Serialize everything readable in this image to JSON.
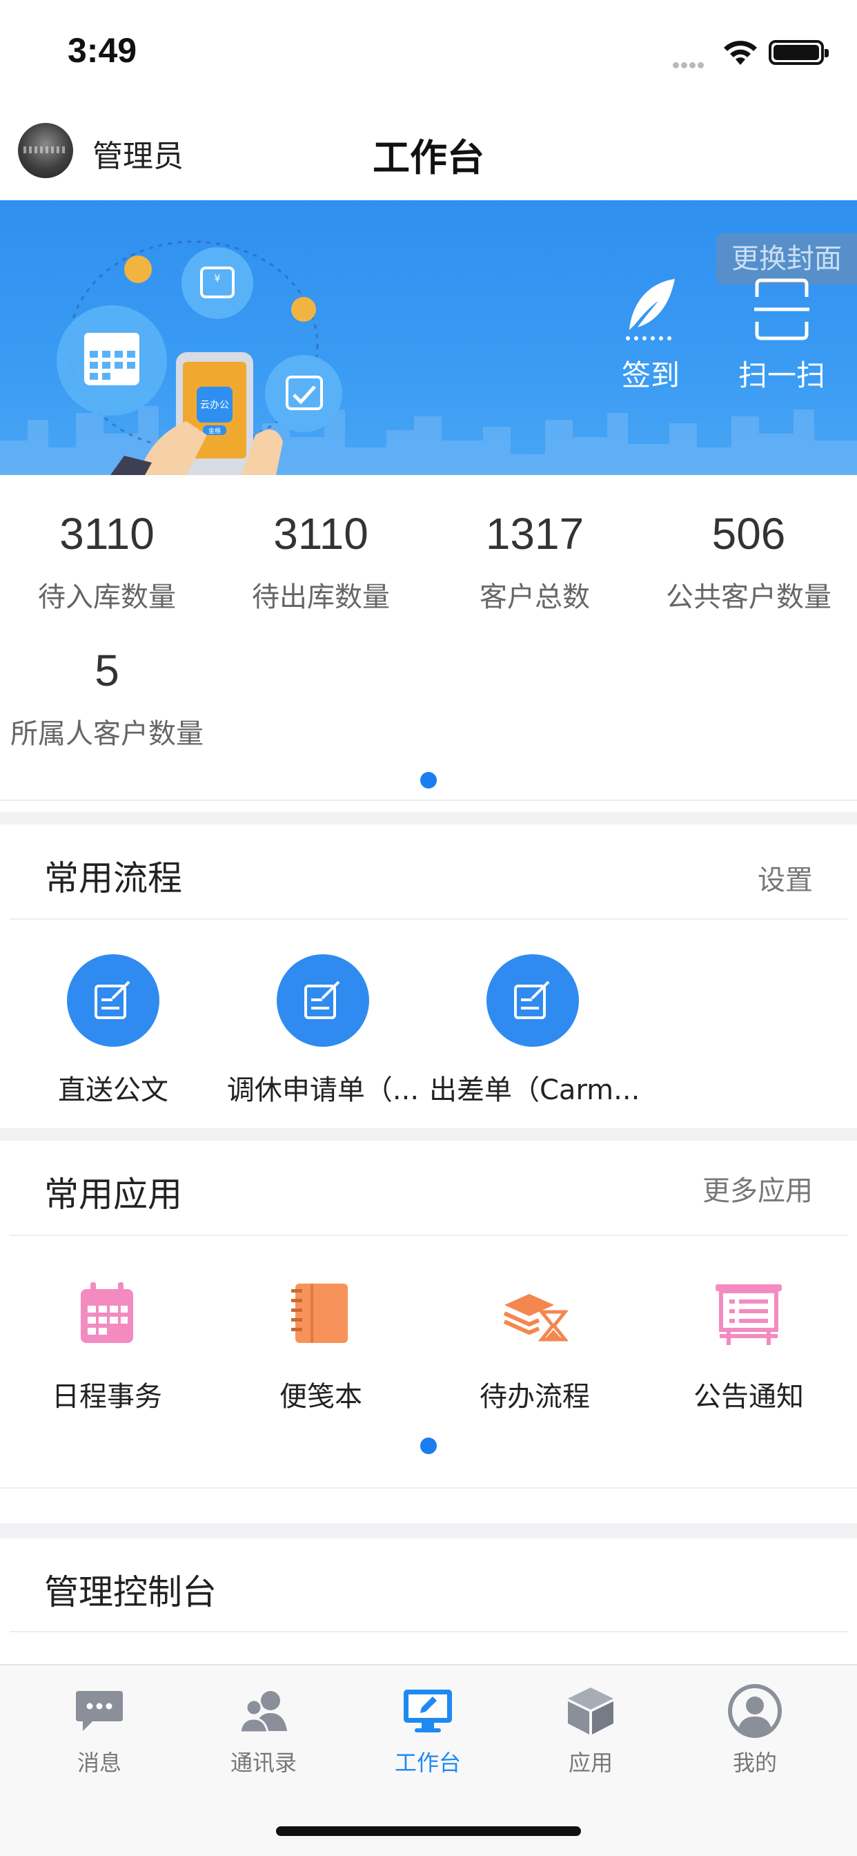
{
  "status_bar": {
    "time": "3:49"
  },
  "header": {
    "user_name": "管理员",
    "title": "工作台"
  },
  "banner": {
    "change_cover": "更换封面",
    "actions": [
      {
        "label": "签到",
        "icon": "feather-icon"
      },
      {
        "label": "扫一扫",
        "icon": "scan-icon"
      }
    ],
    "illustration_label": "云办公",
    "illustration_sub": "金格"
  },
  "stats": [
    {
      "value": "3110",
      "label": "待入库数量"
    },
    {
      "value": "3110",
      "label": "待出库数量"
    },
    {
      "value": "1317",
      "label": "客户总数"
    },
    {
      "value": "506",
      "label": "公共客户数量"
    },
    {
      "value": "5",
      "label": "所属人客户数量"
    }
  ],
  "processes": {
    "title": "常用流程",
    "link": "设置",
    "items": [
      {
        "label": "直送公文"
      },
      {
        "label": "调休申请单（..."
      },
      {
        "label": "出差单（Carm..."
      }
    ]
  },
  "apps": {
    "title": "常用应用",
    "link": "更多应用",
    "items": [
      {
        "label": "日程事务",
        "icon": "calendar-icon",
        "color": "#f38bc0"
      },
      {
        "label": "便笺本",
        "icon": "notebook-icon",
        "color": "#f7935a"
      },
      {
        "label": "待办流程",
        "icon": "hourglass-stack-icon",
        "color": "#f3874f"
      },
      {
        "label": "公告通知",
        "icon": "notice-board-icon",
        "color": "#f38bc0"
      }
    ]
  },
  "console": {
    "title": "管理控制台"
  },
  "tabbar": {
    "items": [
      {
        "label": "消息",
        "icon": "chat-icon"
      },
      {
        "label": "通讯录",
        "icon": "contacts-icon"
      },
      {
        "label": "工作台",
        "icon": "workbench-icon",
        "active": true
      },
      {
        "label": "应用",
        "icon": "cube-icon"
      },
      {
        "label": "我的",
        "icon": "profile-icon"
      }
    ]
  },
  "colors": {
    "accent": "#1e8af0",
    "banner": "#3a9bf3",
    "section_gap": "#f1f2f4"
  }
}
